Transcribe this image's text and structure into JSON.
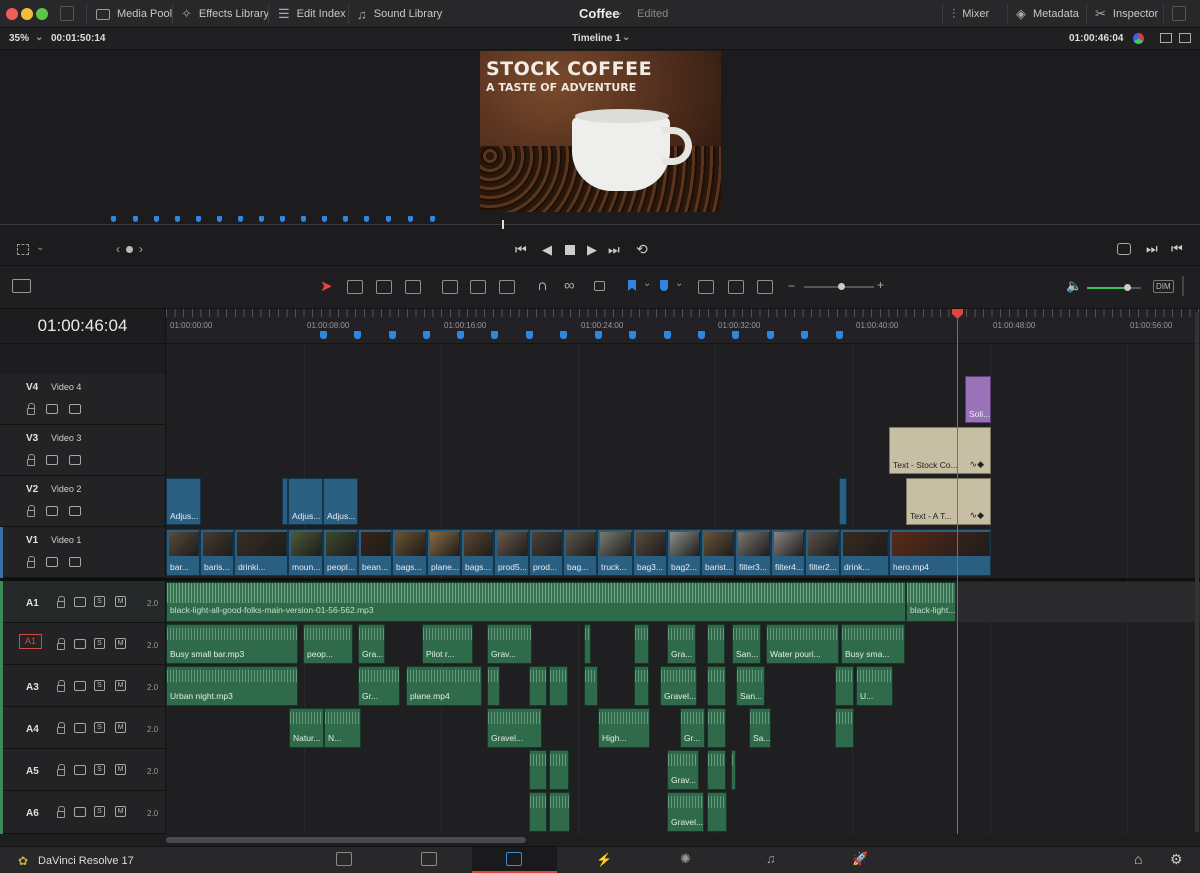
{
  "app": {
    "project_title": "Coffee",
    "project_status": "Edited",
    "product_name": "DaVinci Resolve 17"
  },
  "top_nav": {
    "left_items": [
      {
        "label": "Media Pool",
        "icon": "media-pool-icon"
      },
      {
        "label": "Effects Library",
        "icon": "effects-library-icon"
      },
      {
        "label": "Edit Index",
        "icon": "edit-index-icon"
      },
      {
        "label": "Sound Library",
        "icon": "sound-library-icon"
      }
    ],
    "right_items": [
      {
        "label": "Mixer",
        "icon": "mixer-icon"
      },
      {
        "label": "Metadata",
        "icon": "metadata-icon"
      },
      {
        "label": "Inspector",
        "icon": "inspector-icon"
      }
    ]
  },
  "viewer": {
    "zoom": "35%",
    "duration": "00:01:50:14",
    "timeline_name": "Timeline 1",
    "current_timecode": "01:00:46:04",
    "frame_title": "STOCK COFFEE",
    "frame_subtitle": "A TASTE OF ADVENTURE"
  },
  "timeline": {
    "timecode": "01:00:46:04",
    "ruler_ticks": [
      "01:00:00:00",
      "01:00:08:00",
      "01:00:16:00",
      "01:00:24:00",
      "01:00:32:00",
      "01:00:40:00",
      "01:00:48:00",
      "01:00:56:00"
    ],
    "audio_slider_label": "DIM",
    "playhead_fraction": 0.7663
  },
  "tracks": {
    "video": [
      {
        "id": "V4",
        "name": "Video 4"
      },
      {
        "id": "V3",
        "name": "Video 3"
      },
      {
        "id": "V2",
        "name": "Video 2"
      },
      {
        "id": "V1",
        "name": "Video 1"
      }
    ],
    "audio": [
      {
        "id": "A1",
        "level": "2.0"
      },
      {
        "id": "A1",
        "level": "2.0"
      },
      {
        "id": "A3",
        "level": "2.0"
      },
      {
        "id": "A4",
        "level": "2.0"
      },
      {
        "id": "A5",
        "level": "2.0"
      },
      {
        "id": "A6",
        "level": "2.0"
      }
    ],
    "solo_label": "S",
    "mute_label": "M"
  },
  "clips": {
    "v4": [
      "Soli..."
    ],
    "v3": [
      "Text - Stock Co..."
    ],
    "v2": [
      "Adjus...",
      "Adjus...",
      "Adjus...",
      "Text - A T..."
    ],
    "v1": [
      "bar...",
      "baris...",
      "drinki...",
      "moun...",
      "peopl...",
      "bean...",
      "bags...",
      "plane...",
      "bags...",
      "prod5...",
      "prod...",
      "bag...",
      "truck...",
      "bag3...",
      "bag2...",
      "barist...",
      "filter3...",
      "filter4...",
      "filter2...",
      "drink...",
      "hero.mp4"
    ],
    "a1": [
      "black-light-all-good-folks-main-version-01-56-562.mp3",
      "black-light..."
    ],
    "a2": [
      "Busy small bar.mp3",
      "peop...",
      "Gra...",
      "Pilot r...",
      "Grav...",
      "Gra...",
      "San...",
      "Water pouri...",
      "Busy sma..."
    ],
    "a3": [
      "Urban night.mp3",
      "Gr...",
      "plane.mp4",
      "Gravel...",
      "San...",
      "U..."
    ],
    "a4": [
      "Natur...",
      "N...",
      "Gravel...",
      "High...",
      "Gr...",
      "Sa..."
    ],
    "a5": [
      "Grav..."
    ],
    "a6": [
      "Gravel..."
    ]
  },
  "colors": {
    "video_clip": "#2b5f82",
    "audio_clip": "#2f6b4a",
    "title_clip": "#c7bfa4",
    "solid_clip": "#9a72b8",
    "playhead": "#e0453a",
    "marker": "#2f86e0"
  }
}
